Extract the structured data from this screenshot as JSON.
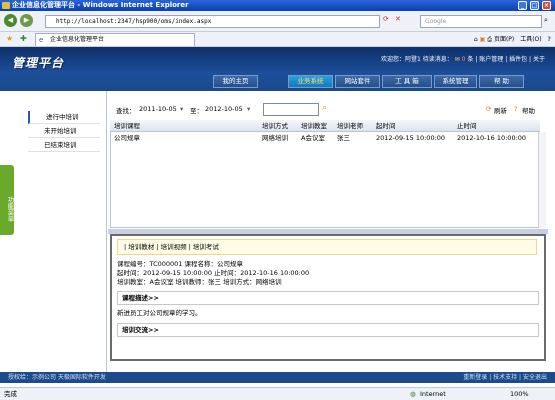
{
  "window": {
    "title": "企业信息化管理平台 - Windows Internet Explorer"
  },
  "browser": {
    "url": "http://localhost:2347/hsp900/oms/index.aspx",
    "search_placeholder": "Google",
    "tab_title": "企业信息化管理平台",
    "tools": {
      "home": "",
      "page": "页面(P)",
      "tools": "工具(O)",
      "help": "?"
    }
  },
  "app": {
    "logo_text": "管理平台",
    "welcome": "欢迎您：阿登1 待读消息：",
    "msg_count": "0",
    "msg_unit": "条",
    "links": [
      "账户管理",
      "插件包",
      "关于"
    ],
    "menu": [
      "我的主页",
      "业务系统",
      "网站套件",
      "工 具 箱",
      "系统管理",
      "帮 助"
    ]
  },
  "sidebar": {
    "items": [
      "进行中培训",
      "未开始培训",
      "已结束培训"
    ],
    "func_tab": "功能菜单"
  },
  "toolbar": {
    "query_label": "查找：",
    "from_date": "2011-10-05",
    "to_label": "至：",
    "to_date": "2012-10-05",
    "refresh": "刷新",
    "help": "帮助"
  },
  "grid": {
    "columns": [
      "培训课程",
      "培训方式",
      "培训教室",
      "培训老师",
      "起时间",
      "止时间"
    ],
    "rows": [
      [
        "公司规章",
        "网络培训",
        "A会议室",
        "张三",
        "2012-09-15 10:00:00",
        "2012-10-16 10:00:00"
      ]
    ]
  },
  "detail": {
    "tabs": "| 培训教材 | 培训视频 | 培训考试",
    "line1": "课程编号：TC000001  课程名称：公司规章",
    "line2": "起时间：2012-09-15 10:00:00  止时间：2012-10-16 10:00:00",
    "line3": "培训教室：A会议室  培训教师：张三  培训方式：网络培训",
    "desc_head": "课程描述>>",
    "desc_text": "新进员工对公司规章的学习。",
    "comm_head": "培训交流>>"
  },
  "footer": {
    "left": "授权给：示例公司  天极国际软件开发",
    "right": [
      "重新登录",
      "技术支持",
      "安全退出"
    ]
  },
  "status": {
    "left": "完成",
    "zone": "Internet",
    "zoom": "100%"
  }
}
